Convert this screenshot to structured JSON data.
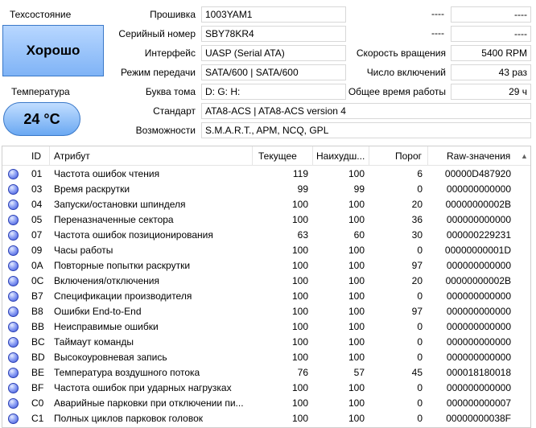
{
  "status": {
    "health_label": "Техсостояние",
    "health_value": "Хорошо",
    "temp_label": "Температура",
    "temp_value": "24 °C"
  },
  "info": {
    "firmware_label": "Прошивка",
    "firmware": "1003YAM1",
    "serial_label": "Серийный номер",
    "serial": "SBY78KR4",
    "interface_label": "Интерфейс",
    "interface": "UASP (Serial ATA)",
    "transfer_label": "Режим передачи",
    "transfer": "SATA/600 | SATA/600",
    "volume_label": "Буква тома",
    "volume": "D: G: H:",
    "standard_label": "Стандарт",
    "standard": "ATA8-ACS | ATA8-ACS version 4",
    "features_label": "Возможности",
    "features": "S.M.A.R.T., APM, NCQ, GPL",
    "right_top_1a": "----",
    "right_top_1b": "----",
    "right_top_2a": "----",
    "right_top_2b": "----",
    "rotation_label": "Скорость вращения",
    "rotation": "5400 RPM",
    "power_on_count_label": "Число включений",
    "power_on_count": "43 раз",
    "power_on_hours_label": "Общее время работы",
    "power_on_hours": "29 ч"
  },
  "table": {
    "headers": {
      "id": "ID",
      "attribute": "Атрибут",
      "current": "Текущее",
      "worst": "Наихудш...",
      "threshold": "Порог",
      "raw": "Raw-значения"
    },
    "rows": [
      {
        "id": "01",
        "name": "Частота ошибок чтения",
        "current": "119",
        "worst": "100",
        "threshold": "6",
        "raw": "00000D487920"
      },
      {
        "id": "03",
        "name": "Время раскрутки",
        "current": "99",
        "worst": "99",
        "threshold": "0",
        "raw": "000000000000"
      },
      {
        "id": "04",
        "name": "Запуски/остановки шпинделя",
        "current": "100",
        "worst": "100",
        "threshold": "20",
        "raw": "00000000002B"
      },
      {
        "id": "05",
        "name": "Переназначенные сектора",
        "current": "100",
        "worst": "100",
        "threshold": "36",
        "raw": "000000000000"
      },
      {
        "id": "07",
        "name": "Частота ошибок позиционирования",
        "current": "63",
        "worst": "60",
        "threshold": "30",
        "raw": "000000229231"
      },
      {
        "id": "09",
        "name": "Часы работы",
        "current": "100",
        "worst": "100",
        "threshold": "0",
        "raw": "00000000001D"
      },
      {
        "id": "0A",
        "name": "Повторные попытки раскрутки",
        "current": "100",
        "worst": "100",
        "threshold": "97",
        "raw": "000000000000"
      },
      {
        "id": "0C",
        "name": "Включения/отключения",
        "current": "100",
        "worst": "100",
        "threshold": "20",
        "raw": "00000000002B"
      },
      {
        "id": "B7",
        "name": "Спецификации производителя",
        "current": "100",
        "worst": "100",
        "threshold": "0",
        "raw": "000000000000"
      },
      {
        "id": "B8",
        "name": "Ошибки End-to-End",
        "current": "100",
        "worst": "100",
        "threshold": "97",
        "raw": "000000000000"
      },
      {
        "id": "BB",
        "name": "Неисправимые ошибки",
        "current": "100",
        "worst": "100",
        "threshold": "0",
        "raw": "000000000000"
      },
      {
        "id": "BC",
        "name": "Таймаут команды",
        "current": "100",
        "worst": "100",
        "threshold": "0",
        "raw": "000000000000"
      },
      {
        "id": "BD",
        "name": "Высокоуровневая запись",
        "current": "100",
        "worst": "100",
        "threshold": "0",
        "raw": "000000000000"
      },
      {
        "id": "BE",
        "name": "Температура воздушного потока",
        "current": "76",
        "worst": "57",
        "threshold": "45",
        "raw": "000018180018"
      },
      {
        "id": "BF",
        "name": "Частота ошибок при ударных нагрузках",
        "current": "100",
        "worst": "100",
        "threshold": "0",
        "raw": "000000000000"
      },
      {
        "id": "C0",
        "name": "Аварийные парковки при отключении пи...",
        "current": "100",
        "worst": "100",
        "threshold": "0",
        "raw": "000000000007"
      },
      {
        "id": "C1",
        "name": "Полных циклов парковок головок",
        "current": "100",
        "worst": "100",
        "threshold": "0",
        "raw": "00000000038F"
      }
    ]
  },
  "colors": {
    "health_bg": "#8fbdf8",
    "status_dot": "#5a70e6"
  }
}
